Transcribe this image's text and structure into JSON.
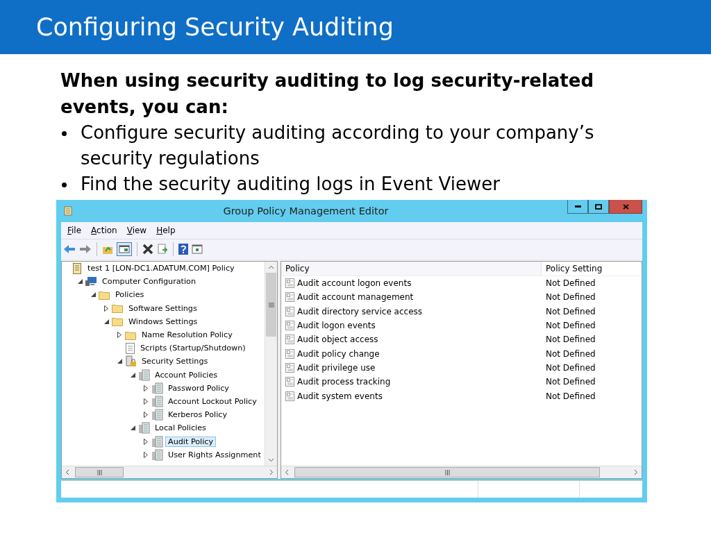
{
  "slide": {
    "title": "Configuring Security Auditing",
    "lead": "When using security auditing to log security-related events, you can:",
    "bullets": [
      "Configure security auditing according to your company’s security regulations",
      "Find the security auditing logs in Event Viewer"
    ]
  },
  "window": {
    "title": "Group Policy Management Editor",
    "menu": [
      "File",
      "Action",
      "View",
      "Help"
    ],
    "tree": [
      {
        "label": "test 1 [LON-DC1.ADATUM.COM] Policy",
        "kind": "gpo",
        "selected": false,
        "children": [
          {
            "label": "Computer Configuration",
            "kind": "computer",
            "expanded": true,
            "selected": false,
            "children": [
              {
                "label": "Policies",
                "kind": "folder",
                "expanded": true,
                "selected": false,
                "children": [
                  {
                    "label": "Software Settings",
                    "kind": "folder",
                    "expanded": false,
                    "selected": false
                  },
                  {
                    "label": "Windows Settings",
                    "kind": "folder",
                    "expanded": true,
                    "selected": false,
                    "children": [
                      {
                        "label": "Name Resolution Policy",
                        "kind": "folder",
                        "expanded": false,
                        "selected": false
                      },
                      {
                        "label": "Scripts (Startup/Shutdown)",
                        "kind": "script",
                        "selected": false
                      },
                      {
                        "label": "Security Settings",
                        "kind": "security",
                        "expanded": true,
                        "selected": false,
                        "children": [
                          {
                            "label": "Account Policies",
                            "kind": "policy",
                            "expanded": true,
                            "selected": false,
                            "children": [
                              {
                                "label": "Password Policy",
                                "kind": "policy",
                                "expanded": false,
                                "selected": false
                              },
                              {
                                "label": "Account Lockout Policy",
                                "kind": "policy",
                                "expanded": false,
                                "selected": false
                              },
                              {
                                "label": "Kerberos Policy",
                                "kind": "policy",
                                "expanded": false,
                                "selected": false
                              }
                            ]
                          },
                          {
                            "label": "Local Policies",
                            "kind": "policy",
                            "expanded": true,
                            "selected": false,
                            "children": [
                              {
                                "label": "Audit Policy",
                                "kind": "policy",
                                "expanded": false,
                                "selected": true
                              },
                              {
                                "label": "User Rights Assignment",
                                "kind": "policy",
                                "expanded": false,
                                "selected": false
                              }
                            ]
                          }
                        ]
                      }
                    ]
                  }
                ]
              }
            ]
          }
        ]
      }
    ],
    "table": {
      "columns": [
        "Policy",
        "Policy Setting"
      ],
      "rows": [
        {
          "policy": "Audit account logon events",
          "setting": "Not Defined"
        },
        {
          "policy": "Audit account management",
          "setting": "Not Defined"
        },
        {
          "policy": "Audit directory service access",
          "setting": "Not Defined"
        },
        {
          "policy": "Audit logon events",
          "setting": "Not Defined"
        },
        {
          "policy": "Audit object access",
          "setting": "Not Defined"
        },
        {
          "policy": "Audit policy change",
          "setting": "Not Defined"
        },
        {
          "policy": "Audit privilege use",
          "setting": "Not Defined"
        },
        {
          "policy": "Audit process tracking",
          "setting": "Not Defined"
        },
        {
          "policy": "Audit system events",
          "setting": "Not Defined"
        }
      ]
    }
  }
}
